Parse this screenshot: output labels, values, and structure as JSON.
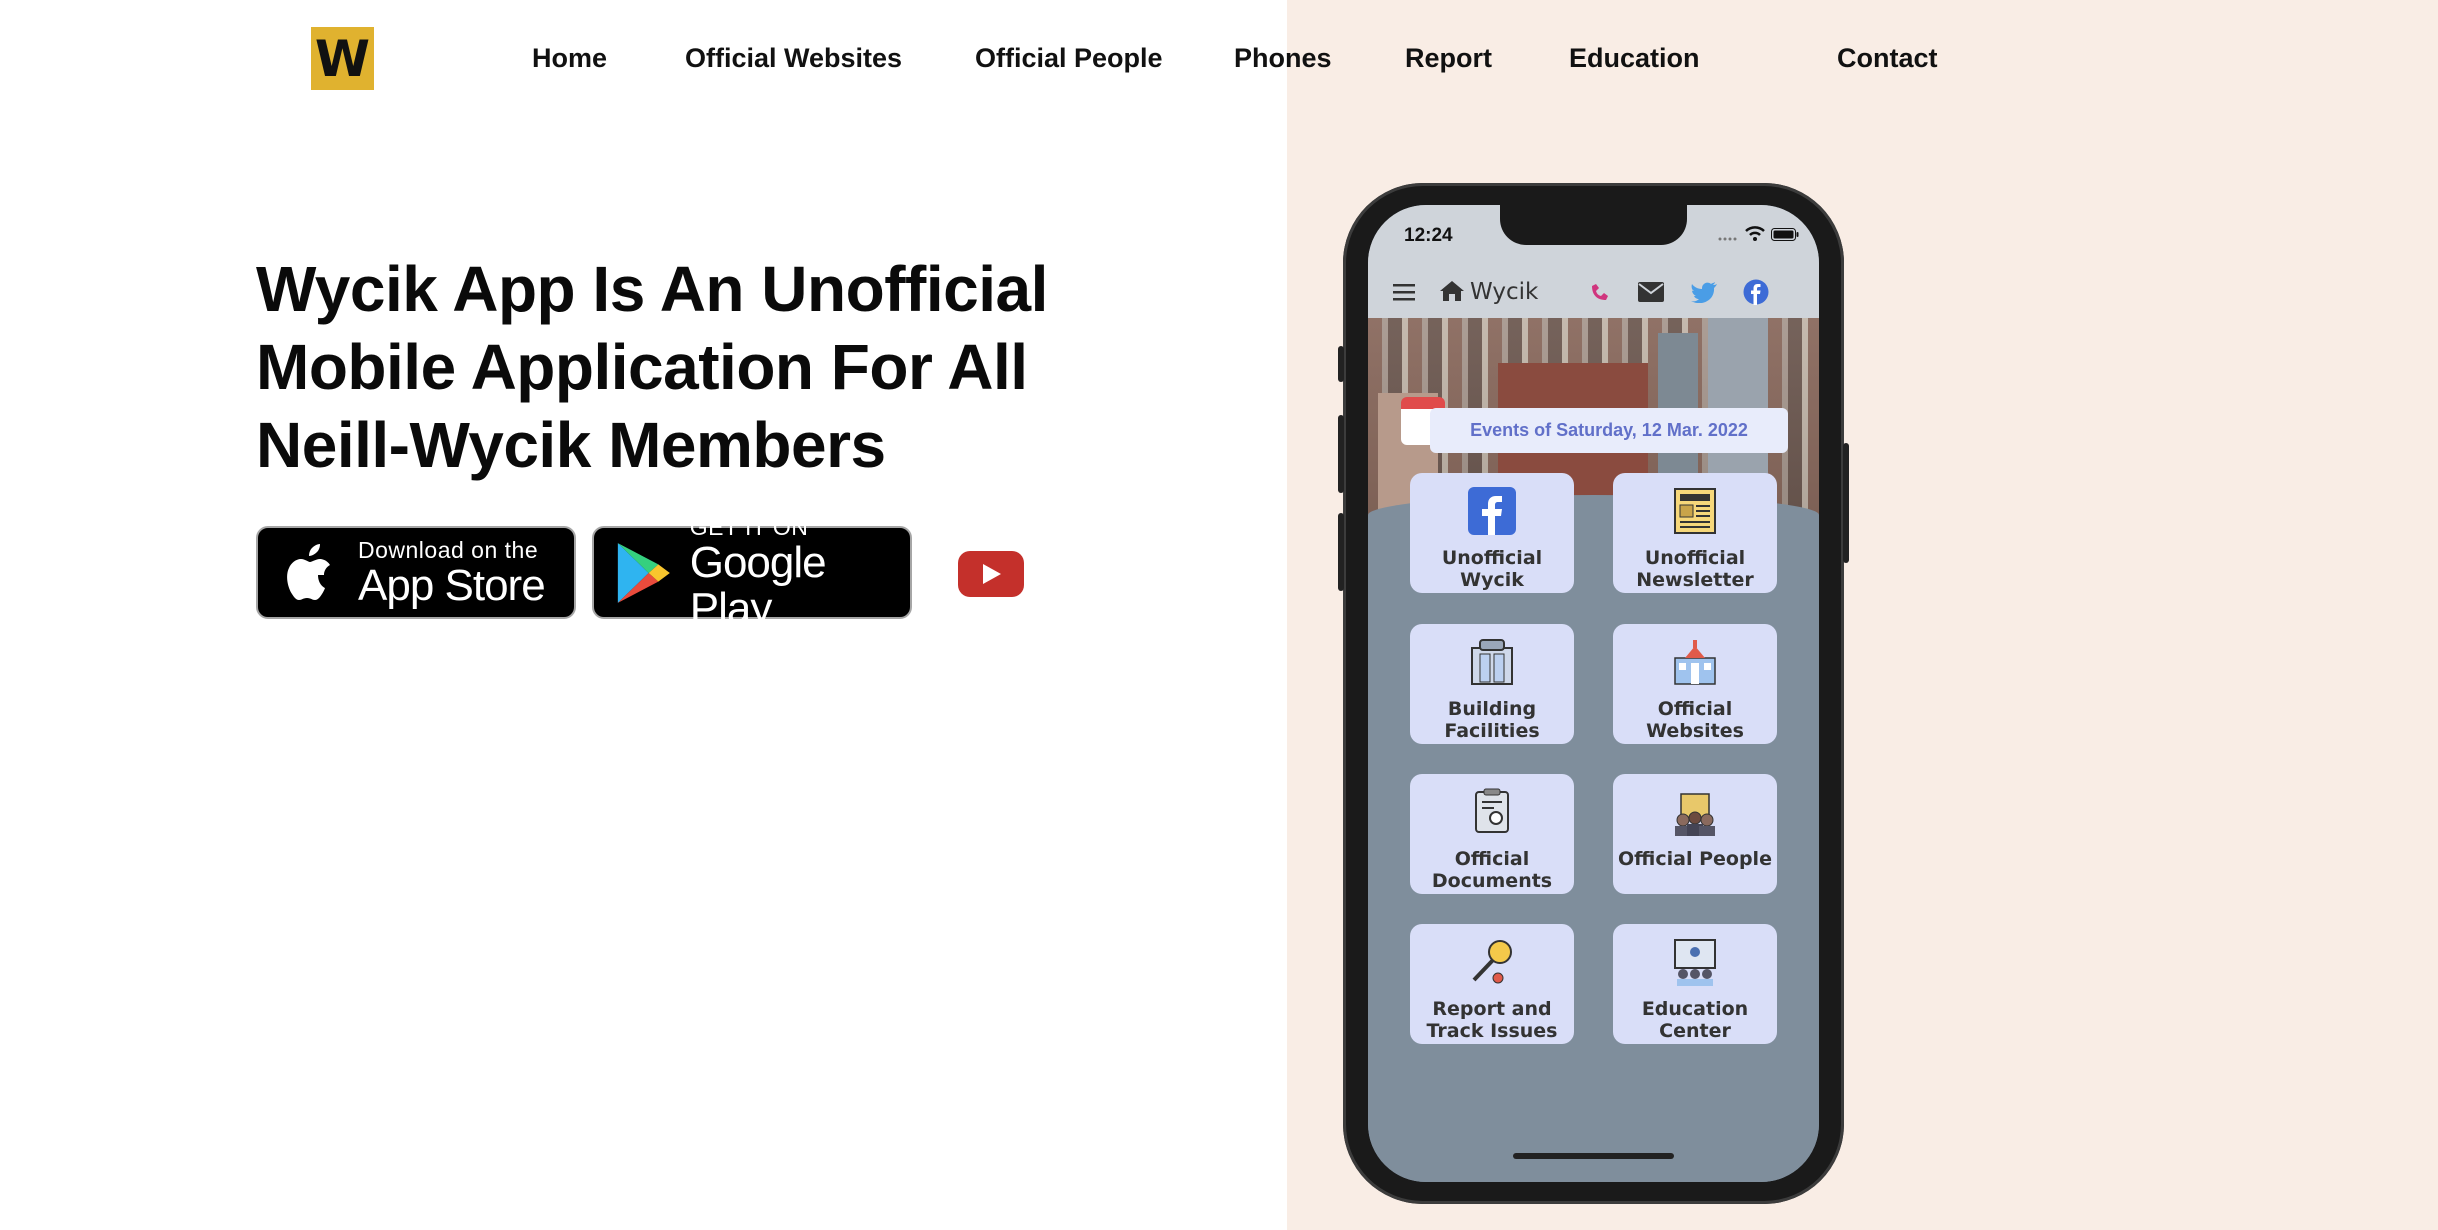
{
  "brand": {
    "logo_letter": "W",
    "logo_color": "#e0b22f"
  },
  "nav": {
    "items": [
      "Home",
      "Official Websites",
      "Official People",
      "Phones",
      "Report",
      "Education",
      "Contact"
    ]
  },
  "hero": {
    "title": "Wycik App Is An Unofficial Mobile Application For All Neill-Wycik Members",
    "app_store": {
      "small": "Download on the",
      "big": "App Store"
    },
    "google_play": {
      "small": "GET IT ON",
      "big": "Google Play"
    },
    "youtube_icon": "youtube-play-icon"
  },
  "phone": {
    "time": "12:24",
    "app_title": "Wycik",
    "event_banner": "Events of Saturday, 12 Mar. 2022",
    "tiles": [
      {
        "label": "Unofficial Wycik",
        "icon": "facebook-icon"
      },
      {
        "label": "Unofficial Newsletter",
        "icon": "newspaper-icon"
      },
      {
        "label": "Building Facilities",
        "icon": "building-facilities-icon"
      },
      {
        "label": "Official Websites",
        "icon": "official-websites-icon"
      },
      {
        "label": "Official Documents",
        "icon": "documents-icon"
      },
      {
        "label": "Official People",
        "icon": "people-icon"
      },
      {
        "label": "Report and Track Issues",
        "icon": "report-icon"
      },
      {
        "label": "Education Center",
        "icon": "education-icon"
      }
    ]
  },
  "colors": {
    "right_panel": "#f9ede5",
    "tile_bg": "#d9def8",
    "phone_bg": "#7f8e9c",
    "event_text": "#6170c9"
  }
}
